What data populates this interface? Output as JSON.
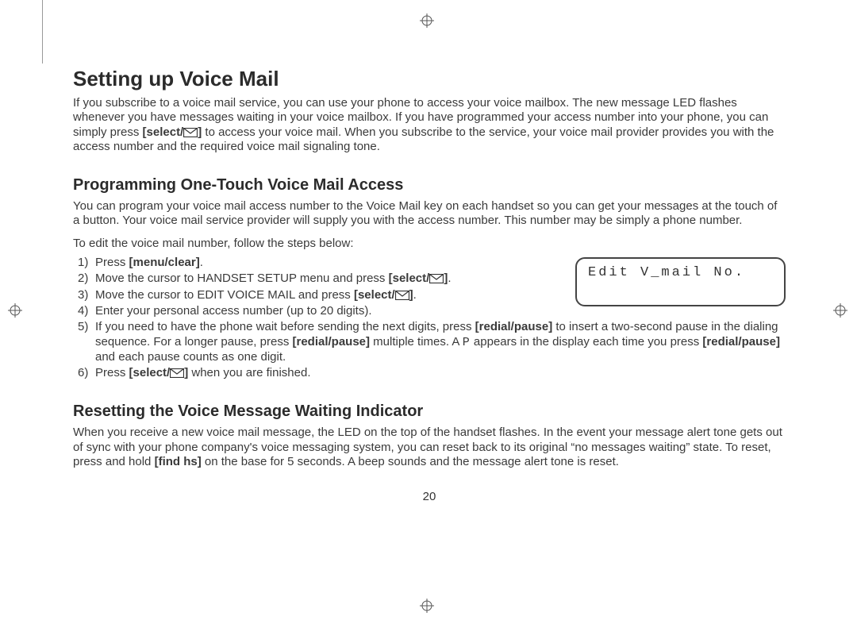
{
  "page_number": "20",
  "h1": "Setting up Voice Mail",
  "intro_p1a": "If you subscribe to a voice mail service, you can use your phone to access your voice mailbox. The new message LED flashes whenever you have messages waiting in your voice mailbox. If you have programmed your access number into your phone, you can simply press ",
  "intro_p1b": " to access your voice mail. When you subscribe to the service, your voice mail provider provides you with the access number and the required voice mail signaling tone.",
  "h2a": "Programming One-Touch Voice Mail Access",
  "prog_intro": "You can program your voice mail access number to the Voice Mail key on each handset so you can get your messages at the touch of a button. Your voice mail service provider will supply you with the access number. This number may be simply a phone number.",
  "prog_follow": "To edit the voice mail number, follow the steps below:",
  "lcd_text": "Edit V_mail No.",
  "step1a": "Press ",
  "step1b": ".",
  "step2a": "Move the cursor to HANDSET SETUP menu and press ",
  "step2b": ".",
  "step3a": "Move the cursor to EDIT VOICE MAIL and press ",
  "step3b": ".",
  "step4": "Enter your personal access number (up to 20 digits).",
  "step5a": "If you need to have the phone wait before sending the next digits, press ",
  "step5b": " to insert a two-second pause in the dialing sequence. For a longer pause, press ",
  "step5c": " multiple times. A ",
  "step5d": " appears in the display each time you press ",
  "step5e": " and each pause counts as one digit.",
  "step6a": "Press ",
  "step6b": " when you are finished.",
  "h2b": "Resetting the Voice Message Waiting Indicator",
  "reset_p1a": "When you receive a new voice mail message, the LED on the top of the handset flashes. In the event your message alert tone gets out of sync with your phone company's voice messaging system, you can reset back to its original “no messages waiting” state. To reset, press and hold ",
  "reset_p1b": " on the base for 5 seconds. A beep sounds and the message alert tone is reset.",
  "kw_select": "[select/",
  "kw_select_close": "]",
  "kw_menuclear": "[menu/clear]",
  "kw_redialpause": "[redial/pause]",
  "kw_findhs": "[find hs]",
  "p_glyph": "P"
}
